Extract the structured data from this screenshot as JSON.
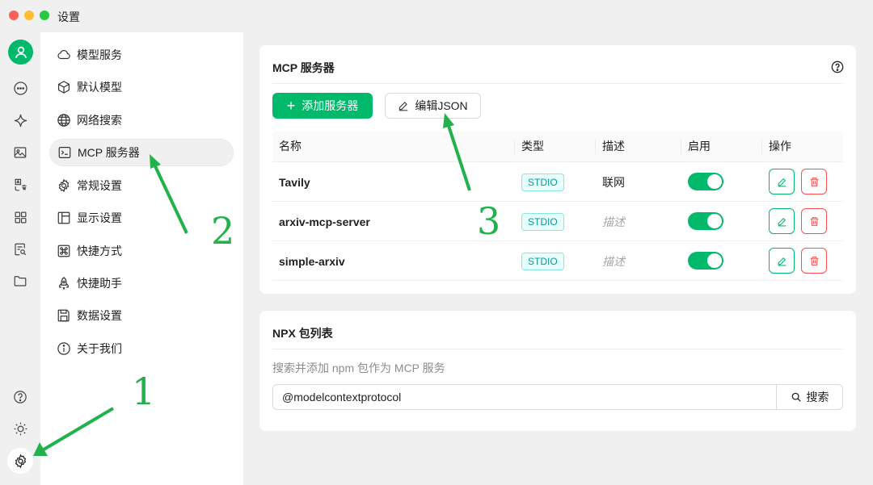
{
  "window": {
    "title": "设置"
  },
  "iconbar": {
    "icons": [
      "user-icon",
      "chat-icon",
      "sparkle-icon",
      "image-icon",
      "translate-icon",
      "apps-icon",
      "document-search-icon",
      "folder-icon"
    ],
    "bottom_icons": [
      "help-icon",
      "sun-icon",
      "settings-icon"
    ]
  },
  "nav": {
    "items": [
      {
        "label": "模型服务",
        "icon": "cloud-icon"
      },
      {
        "label": "默认模型",
        "icon": "cube-icon"
      },
      {
        "label": "网络搜索",
        "icon": "globe-icon"
      },
      {
        "label": "MCP 服务器",
        "icon": "terminal-icon",
        "active": true
      },
      {
        "label": "常规设置",
        "icon": "gear-icon"
      },
      {
        "label": "显示设置",
        "icon": "layout-icon"
      },
      {
        "label": "快捷方式",
        "icon": "command-icon"
      },
      {
        "label": "快捷助手",
        "icon": "rocket-icon"
      },
      {
        "label": "数据设置",
        "icon": "save-icon"
      },
      {
        "label": "关于我们",
        "icon": "info-icon"
      }
    ]
  },
  "mcp": {
    "title": "MCP 服务器",
    "add_label": "添加服务器",
    "edit_json_label": "编辑JSON",
    "columns": [
      "名称",
      "类型",
      "描述",
      "启用",
      "操作"
    ],
    "rows": [
      {
        "name": "Tavily",
        "type": "STDIO",
        "desc": "联网",
        "desc_placeholder": false,
        "enabled": true
      },
      {
        "name": "arxiv-mcp-server",
        "type": "STDIO",
        "desc": "描述",
        "desc_placeholder": true,
        "enabled": true
      },
      {
        "name": "simple-arxiv",
        "type": "STDIO",
        "desc": "描述",
        "desc_placeholder": true,
        "enabled": true
      }
    ]
  },
  "npx": {
    "title": "NPX 包列表",
    "description": "搜索并添加 npm 包作为 MCP 服务",
    "search_value": "@modelcontextprotocol",
    "search_button": "搜索"
  },
  "annotations": {
    "labels": [
      "1",
      "2",
      "3"
    ]
  },
  "colors": {
    "accent": "#00b96b",
    "danger": "#ff4d4f",
    "annotation": "#21b24b"
  }
}
